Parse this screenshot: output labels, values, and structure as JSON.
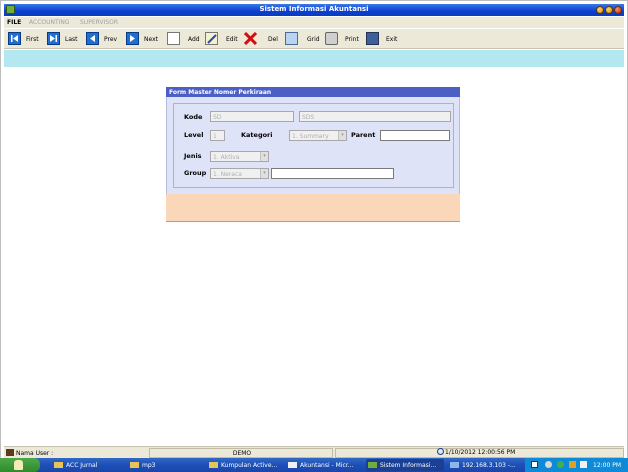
{
  "window": {
    "title": "Sistem Informasi Akuntansi"
  },
  "menu": {
    "file": "FILE",
    "accounting": "ACCOUNTING",
    "supervisor": "SUPERVISOR"
  },
  "toolbar": {
    "first": "First",
    "last": "Last",
    "prev": "Prev",
    "next": "Next",
    "add": "Add",
    "edit": "Edit",
    "del": "Del",
    "grid": "Grid",
    "print": "Print",
    "exit": "Exit"
  },
  "form": {
    "title": "Form Master Nomer Perkiraan",
    "kode_label": "Kode",
    "kode_value": "SD",
    "kode_name": "SDS",
    "level_label": "Level",
    "level_value": "1",
    "kategori_label": "Kategori",
    "kategori_value": "1. Summary",
    "parent_label": "Parent",
    "parent_value": "",
    "jenis_label": "Jenis",
    "jenis_value": "1. Aktiva",
    "group_label": "Group",
    "group_value": "1. Neraca",
    "group_desc": ""
  },
  "status": {
    "user_label": "Nama User :",
    "mode": "DEMO",
    "datetime": "1/10/2012 12:00:56 PM"
  },
  "taskbar": {
    "items": [
      "ACC Jurnal",
      "mp3",
      "Kumpulan Active...",
      "Akuntansi - Micr...",
      "Sistem Informasi...",
      "192.168.3.103 -..."
    ],
    "clock": "12:00 PM"
  },
  "colors": {
    "titlebar": "#0a3fd0",
    "band": "#b3e8f1",
    "form_title": "#4b5fc4",
    "form_body": "#dfe3f8",
    "form_footer": "#fad7b8",
    "taskbar": "#1c4fb8"
  }
}
